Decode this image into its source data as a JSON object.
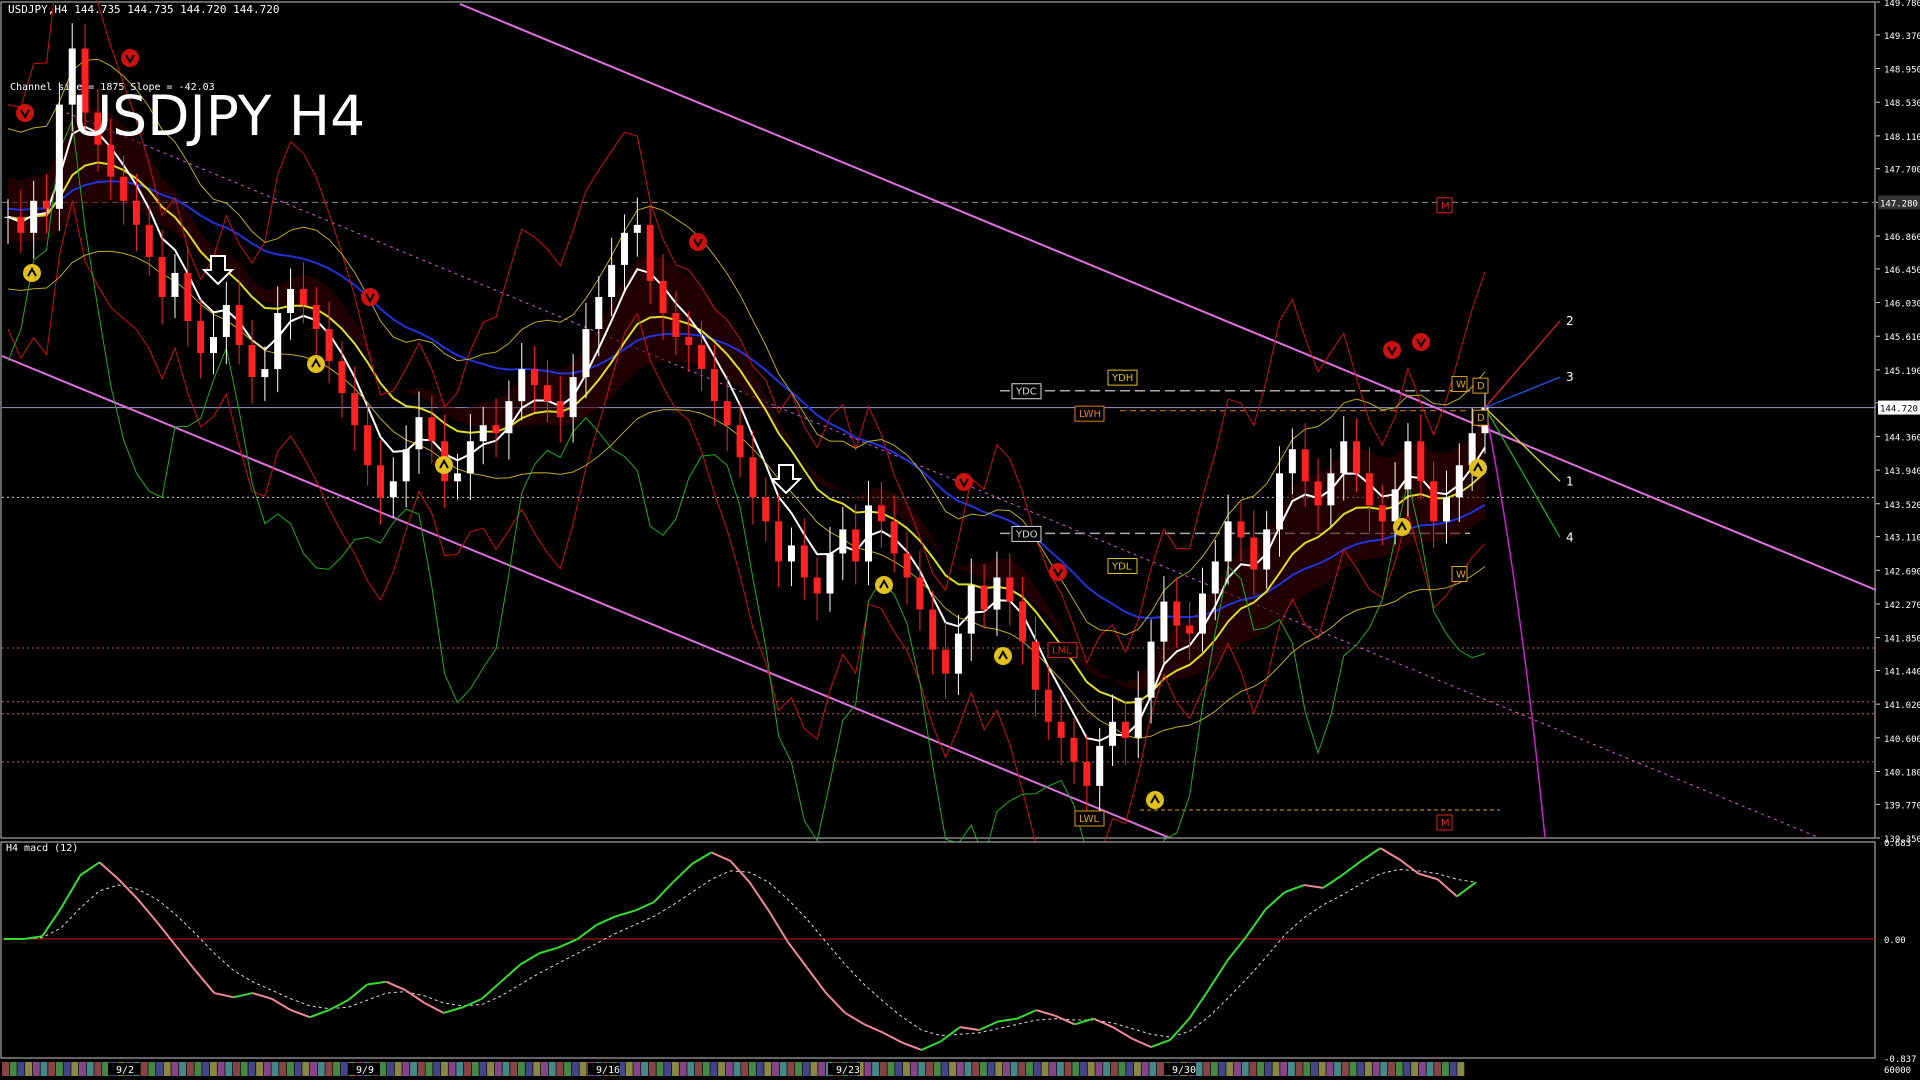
{
  "header": {
    "info": "USDJPY,H4  144.735 144.735 144.720 144.720",
    "channel_info": "Channel size = 1875 Slope = -42.03",
    "big_title": "USDJPY H4"
  },
  "sub": {
    "title": "H4  macd (12)"
  },
  "chart_data": [
    {
      "type": "candlestick",
      "symbol": "USDJPY",
      "timeframe": "H4",
      "ylim": [
        139.35,
        149.78
      ],
      "y_ticks": [
        "149.780",
        "149.370",
        "148.950",
        "148.530",
        "148.110",
        "147.700",
        "147.280",
        "146.860",
        "146.450",
        "146.030",
        "145.610",
        "145.190",
        "144.780",
        "144.360",
        "143.940",
        "143.520",
        "143.110",
        "142.690",
        "142.270",
        "141.850",
        "141.440",
        "141.020",
        "140.600",
        "140.180",
        "139.770",
        "139.350"
      ],
      "current_price": "144.720",
      "marker_price": "147.280",
      "x_labels": [
        "9/2",
        "9/9",
        "9/16",
        "9/23",
        "9/30"
      ],
      "close": [
        147.1,
        146.9,
        147.3,
        147.2,
        148.5,
        149.2,
        148.4,
        148.0,
        147.6,
        147.3,
        147.0,
        146.6,
        146.1,
        146.4,
        145.8,
        145.4,
        145.6,
        146.0,
        145.5,
        145.1,
        145.2,
        145.9,
        146.2,
        146.0,
        145.7,
        145.3,
        144.9,
        144.5,
        144.0,
        143.6,
        143.8,
        144.2,
        144.6,
        144.3,
        143.8,
        143.9,
        144.3,
        144.5,
        144.4,
        144.8,
        145.2,
        145.0,
        144.8,
        144.6,
        145.1,
        145.7,
        146.1,
        146.5,
        146.9,
        147.0,
        146.3,
        145.9,
        145.6,
        145.5,
        145.2,
        144.8,
        144.5,
        144.1,
        143.6,
        143.3,
        142.8,
        143.0,
        142.6,
        142.4,
        142.9,
        143.2,
        142.8,
        143.5,
        143.3,
        142.9,
        142.6,
        142.2,
        141.7,
        141.4,
        141.9,
        142.5,
        142.2,
        142.6,
        142.3,
        141.8,
        141.2,
        140.8,
        140.6,
        140.3,
        140.0,
        140.5,
        140.8,
        140.6,
        141.1,
        141.8,
        142.3,
        142.0,
        141.9,
        142.4,
        142.8,
        143.3,
        143.1,
        142.7,
        143.2,
        143.9,
        144.2,
        143.8,
        143.5,
        143.9,
        144.3,
        143.9,
        143.5,
        143.3,
        143.7,
        144.3,
        143.8,
        143.3,
        143.6,
        144.0,
        144.4,
        144.72
      ],
      "annotations": [
        "YDH",
        "YDC",
        "LWH",
        "YDO",
        "YDL",
        "LWL",
        "LML",
        "M",
        "W",
        "D",
        "1",
        "2",
        "3",
        "4"
      ]
    },
    {
      "type": "line",
      "title": "H4  macd (12)",
      "ylim": [
        -0.837,
        0.683
      ],
      "y_ticks": [
        "0.683",
        "0.00",
        "-0.837"
      ],
      "volume_label": "60000",
      "series": [
        {
          "values": [
            0.0,
            0.0,
            0.02,
            0.22,
            0.45,
            0.54,
            0.42,
            0.28,
            0.12,
            -0.05,
            -0.22,
            -0.38,
            -0.41,
            -0.38,
            -0.42,
            -0.5,
            -0.55,
            -0.5,
            -0.43,
            -0.32,
            -0.3,
            -0.36,
            -0.45,
            -0.52,
            -0.48,
            -0.42,
            -0.3,
            -0.18,
            -0.1,
            -0.06,
            0.0,
            0.1,
            0.16,
            0.2,
            0.26,
            0.4,
            0.53,
            0.61,
            0.55,
            0.4,
            0.2,
            -0.02,
            -0.2,
            -0.38,
            -0.52,
            -0.6,
            -0.66,
            -0.73,
            -0.78,
            -0.72,
            -0.62,
            -0.64,
            -0.58,
            -0.56,
            -0.5,
            -0.54,
            -0.6,
            -0.56,
            -0.62,
            -0.7,
            -0.76,
            -0.71,
            -0.56,
            -0.36,
            -0.15,
            0.02,
            0.21,
            0.33,
            0.38,
            0.36,
            0.45,
            0.55,
            0.64,
            0.56,
            0.46,
            0.42,
            0.3,
            0.4
          ]
        },
        {
          "values": [
            0.0,
            0.0,
            0.01,
            0.08,
            0.22,
            0.34,
            0.38,
            0.35,
            0.28,
            0.17,
            0.04,
            -0.1,
            -0.22,
            -0.3,
            -0.36,
            -0.42,
            -0.47,
            -0.49,
            -0.48,
            -0.43,
            -0.38,
            -0.37,
            -0.4,
            -0.45,
            -0.47,
            -0.46,
            -0.4,
            -0.32,
            -0.24,
            -0.17,
            -0.1,
            -0.03,
            0.04,
            0.1,
            0.16,
            0.24,
            0.33,
            0.42,
            0.48,
            0.47,
            0.4,
            0.28,
            0.14,
            -0.02,
            -0.18,
            -0.32,
            -0.44,
            -0.55,
            -0.64,
            -0.68,
            -0.67,
            -0.66,
            -0.63,
            -0.6,
            -0.57,
            -0.56,
            -0.57,
            -0.57,
            -0.59,
            -0.63,
            -0.67,
            -0.69,
            -0.65,
            -0.55,
            -0.42,
            -0.28,
            -0.13,
            0.03,
            0.15,
            0.24,
            0.31,
            0.39,
            0.46,
            0.49,
            0.48,
            0.46,
            0.42,
            0.4
          ]
        }
      ]
    }
  ]
}
